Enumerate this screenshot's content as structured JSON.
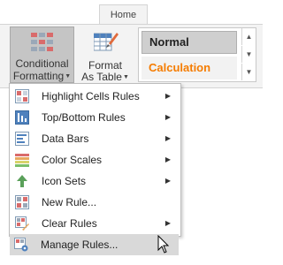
{
  "ribbon": {
    "tab_home": "Home",
    "conditional_formatting": {
      "line1": "Conditional",
      "line2": "Formatting"
    },
    "format_as_table": {
      "line1": "Format",
      "line2": "As Table"
    },
    "styles": [
      {
        "label": "Normal"
      },
      {
        "label": "Calculation",
        "color": "#f57c00"
      }
    ]
  },
  "menu": {
    "items": [
      {
        "label": "Highlight Cells Rules",
        "icon": "highlight-cells-icon",
        "submenu": true
      },
      {
        "label": "Top/Bottom Rules",
        "icon": "top-bottom-icon",
        "submenu": true
      },
      {
        "label": "Data Bars",
        "icon": "data-bars-icon",
        "submenu": true
      },
      {
        "label": "Color Scales",
        "icon": "color-scales-icon",
        "submenu": true
      },
      {
        "label": "Icon Sets",
        "icon": "icon-sets-icon",
        "submenu": true
      },
      {
        "label": "New Rule...",
        "icon": "new-rule-icon",
        "submenu": false
      },
      {
        "label": "Clear Rules",
        "icon": "clear-rules-icon",
        "submenu": true
      },
      {
        "label": "Manage Rules...",
        "icon": "manage-rules-icon",
        "submenu": false,
        "hovered": true
      }
    ]
  },
  "colors": {
    "accent_orange": "#f57c00",
    "hover": "#d9d9d9",
    "pressed": "#c5c5c5"
  }
}
